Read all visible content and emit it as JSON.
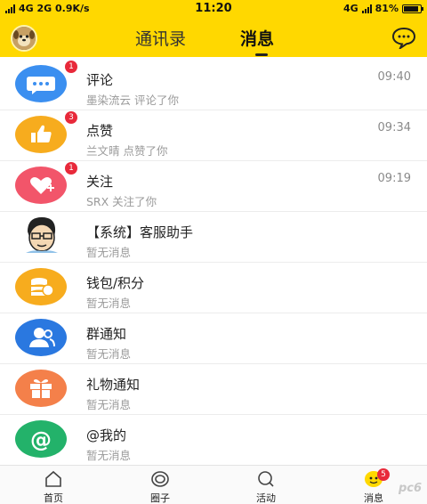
{
  "status_bar": {
    "left": "4G  2G  0.9K/s",
    "time": "11:20",
    "network": "4G",
    "battery": "81%"
  },
  "header": {
    "tabs": [
      {
        "label": "通讯录",
        "active": false
      },
      {
        "label": "消息",
        "active": true
      }
    ]
  },
  "messages": [
    {
      "title": "评论",
      "subtitle": "墨染流云 评论了你",
      "time": "09:40",
      "badge": "1",
      "icon": "comment-icon",
      "color": "#3b8ff0"
    },
    {
      "title": "点赞",
      "subtitle": "兰文晴 点赞了你",
      "time": "09:34",
      "badge": "3",
      "icon": "thumbs-up-icon",
      "color": "#f7ac1e"
    },
    {
      "title": "关注",
      "subtitle": "SRX 关注了你",
      "time": "09:19",
      "badge": "1",
      "icon": "heart-plus-icon",
      "color": "#f2556a"
    },
    {
      "title": "【系统】客服助手",
      "subtitle": "暂无消息",
      "time": "",
      "badge": "",
      "icon": "cartoon-avatar-icon",
      "color": "#ffffff"
    },
    {
      "title": "钱包/积分",
      "subtitle": "暂无消息",
      "time": "",
      "badge": "",
      "icon": "coins-icon",
      "color": "#f7ac1e"
    },
    {
      "title": "群通知",
      "subtitle": "暂无消息",
      "time": "",
      "badge": "",
      "icon": "group-icon",
      "color": "#2a78e0"
    },
    {
      "title": "礼物通知",
      "subtitle": "暂无消息",
      "time": "",
      "badge": "",
      "icon": "gift-icon",
      "color": "#f4804a"
    },
    {
      "title": "@我的",
      "subtitle": "暂无消息",
      "time": "",
      "badge": "",
      "icon": "at-sign-icon",
      "color": "#23b26a"
    }
  ],
  "bottom_nav": [
    {
      "label": "首页",
      "icon": "home-icon"
    },
    {
      "label": "圈子",
      "icon": "circle-icon"
    },
    {
      "label": "活动",
      "icon": "search-icon"
    },
    {
      "label": "消息",
      "icon": "message-face-icon",
      "badge": "5"
    }
  ],
  "watermark": "pc6",
  "colors": {
    "brand": "#ffd800",
    "badge": "#e8293a"
  }
}
